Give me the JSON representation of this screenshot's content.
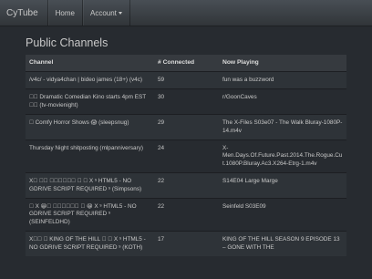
{
  "navbar": {
    "brand": "CyTube",
    "home_label": "Home",
    "account_label": "Account"
  },
  "page_title": "Public Channels",
  "table": {
    "columns": [
      "Channel",
      "# Connected",
      "Now Playing"
    ],
    "rows": [
      {
        "channel": "/v4c/ - vidya4chan | bideo james (18+) (v4c)",
        "connected": "59",
        "playing": "fun was a buzzword"
      },
      {
        "channel": "\u0000\u0000 Dramatic Comedian Kino starts 4pm EST \u0000\u0000 (tv-movienight)",
        "connected": "30",
        "playing": "r/GoonCaves"
      },
      {
        "channel": "\u0000 Comfy Horror Shows 😱 (sleepsnug)",
        "connected": "29",
        "playing": "The X-Files S03e07 - The Walk Bluray-1080P-14.m4v"
      },
      {
        "channel": "Thursday Night shitposting (mlpanniversary)",
        "connected": "24",
        "playing": "X-Men.Days.Of.Future.Past.2014.The.Rogue.Cut.1080P.Bluray.Ac3.X264-Etrg-1.m4v"
      },
      {
        "channel": "X\u0000 \u0000\u0000 \u0000\u0000\u0000\u0000\u0000\u0000 \u0000 \u0000 X ˢ HTML5 - NO GDRIVE SCRIPT REQUIRED ˢ (Simpsons)",
        "connected": "22",
        "playing": "S14E04 Large Marge"
      },
      {
        "channel": "\u0000 X 😀\u0000 \u0000\u0000\u0000\u0000\u0000\u0000 \u0000 😀 X ˢ HTML5 - NO GDRIVE SCRIPT REQUIRED ˢ (SEINFELDHD)",
        "connected": "22",
        "playing": "Seinfeld S03E09"
      },
      {
        "channel": "X\u0000\u0000 \u0000 KING OF THE HILL \u0000 \u0000 X ˢ HTML5 - NO GDRIVE SCRIPT REQUIRED ˢ (KOTH)",
        "connected": "17",
        "playing": "KING OF THE HILL SEASON 9 EPISODE 13 – GONE WITH THE"
      }
    ]
  }
}
